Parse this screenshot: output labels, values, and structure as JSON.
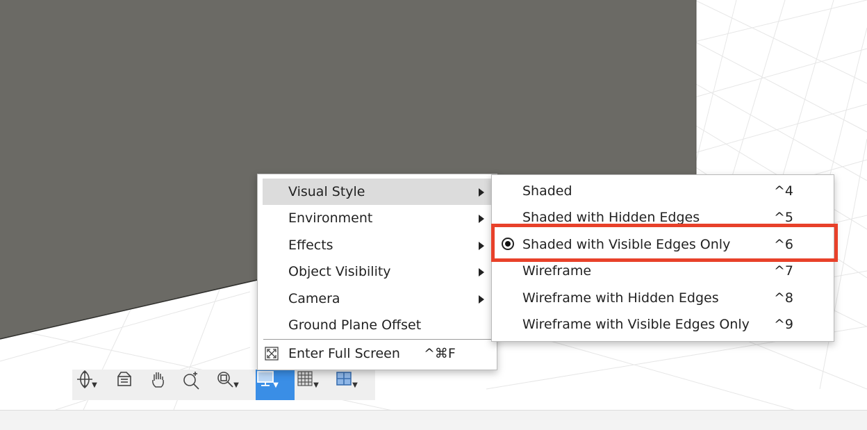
{
  "display_menu": {
    "items": [
      {
        "label": "Visual Style",
        "has_submenu": true,
        "highlighted": true
      },
      {
        "label": "Environment",
        "has_submenu": true
      },
      {
        "label": "Effects",
        "has_submenu": true
      },
      {
        "label": "Object Visibility",
        "has_submenu": true
      },
      {
        "label": "Camera",
        "has_submenu": true
      },
      {
        "label": "Ground Plane Offset",
        "has_submenu": false
      }
    ],
    "fullscreen": {
      "label": "Enter Full Screen",
      "shortcut": "^⌘F",
      "icon": "fullscreen-icon"
    }
  },
  "visual_style_menu": {
    "items": [
      {
        "label": "Shaded",
        "shortcut": "^4"
      },
      {
        "label": "Shaded with Hidden Edges",
        "shortcut": "^5"
      },
      {
        "label": "Shaded with Visible Edges Only",
        "shortcut": "^6",
        "selected": true
      },
      {
        "label": "Wireframe",
        "shortcut": "^7"
      },
      {
        "label": "Wireframe with Hidden Edges",
        "shortcut": "^8"
      },
      {
        "label": "Wireframe with Visible Edges Only",
        "shortcut": "^9"
      }
    ]
  },
  "toolbar": {
    "icons": [
      "orbit-icon",
      "look-at-icon",
      "pan-hand-icon",
      "zoom-icon",
      "fit-zoom-icon",
      "display-settings-icon",
      "grid-snaps-icon",
      "viewports-icon"
    ],
    "active": "display-settings-icon"
  },
  "colors": {
    "model_face": "#6b6a65",
    "active_toolbar": "#3a8ee6",
    "callout": "#e8412a",
    "menu_highlight": "#dcdcdc"
  }
}
